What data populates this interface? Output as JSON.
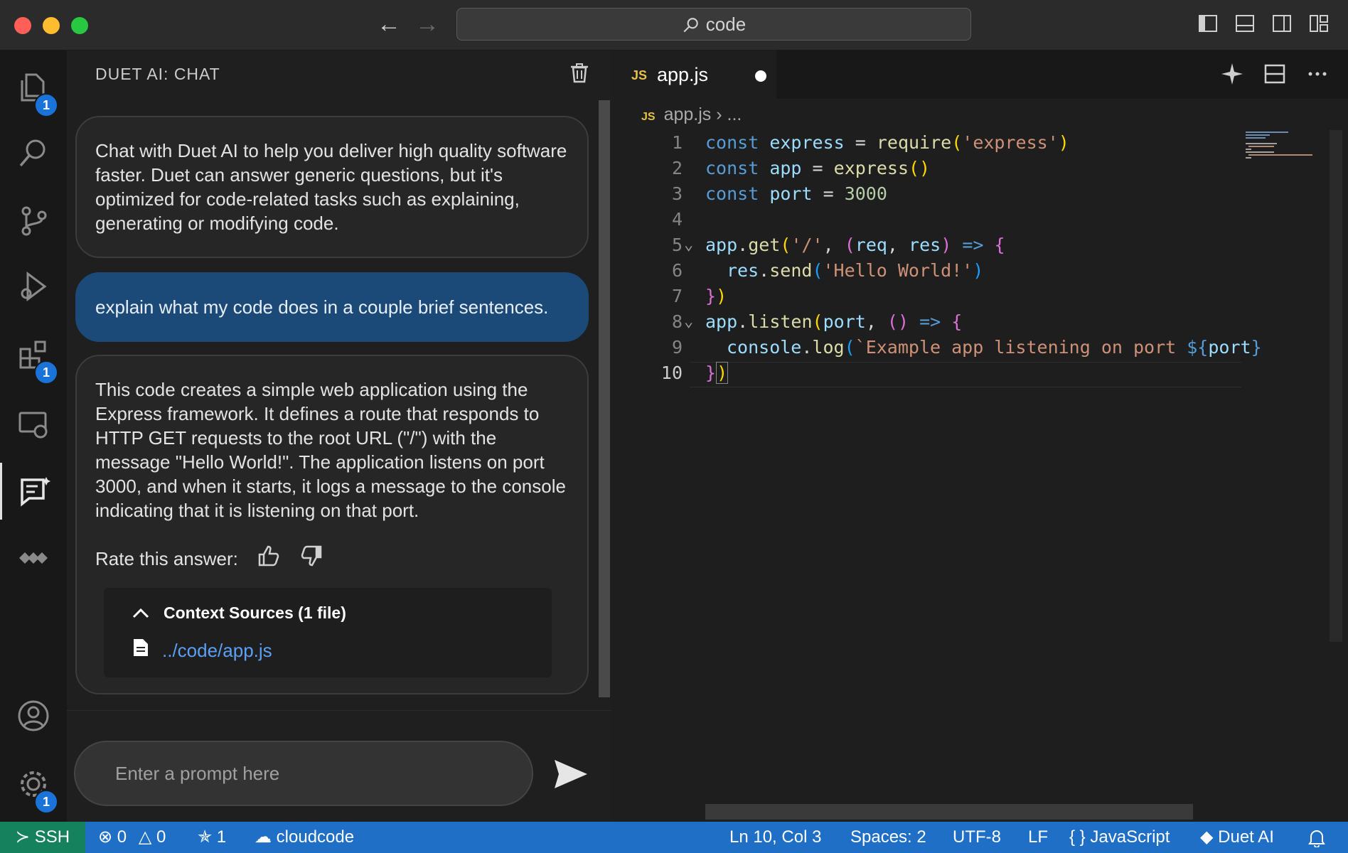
{
  "titlebar": {
    "search_text": "code"
  },
  "activity_bar": {
    "explorer_badge": "1",
    "extensions_badge": "1",
    "settings_badge": "1"
  },
  "chat": {
    "panel_title": "DUET AI: CHAT",
    "intro_message": "Chat with Duet AI to help you deliver high quality software faster. Duet can answer generic questions, but it's optimized for code-related tasks such as explaining, generating or modifying code.",
    "user_message": "explain what my code does in a couple brief sentences.",
    "ai_answer": "This code creates a simple web application using the Express framework. It defines a route that responds to HTTP GET requests to the root URL (\"/\") with the message \"Hello World!\". The application listens on port 3000, and when it starts, it logs a message to the console indicating that it is listening on that port.",
    "rate_label": "Rate this answer:",
    "context_title": "Context Sources (1 file)",
    "context_file": "../code/app.js",
    "prompt_placeholder": "Enter a prompt here"
  },
  "editor": {
    "tab_badge": "JS",
    "tab_name": "app.js",
    "breadcrumb_file": "app.js",
    "breadcrumb_rest": "...",
    "lines": [
      {
        "n": "1",
        "text": "const express = require('express')"
      },
      {
        "n": "2",
        "text": "const app = express()"
      },
      {
        "n": "3",
        "text": "const port = 3000"
      },
      {
        "n": "4",
        "text": ""
      },
      {
        "n": "5",
        "text": "app.get('/', (req, res) => {"
      },
      {
        "n": "6",
        "text": "res.send('Hello World!')"
      },
      {
        "n": "7",
        "text": "})"
      },
      {
        "n": "8",
        "text": "app.listen(port, () => {"
      },
      {
        "n": "9",
        "text": "console.log(`Example app listening on port ${port}"
      },
      {
        "n": "10",
        "text": "})"
      }
    ]
  },
  "statusbar": {
    "remote": "SSH",
    "errors": "0",
    "warnings": "0",
    "ports": "1",
    "cloud": "cloudcode",
    "position": "Ln 10, Col 3",
    "spaces": "Spaces: 2",
    "encoding": "UTF-8",
    "eol": "LF",
    "language": "JavaScript",
    "duet": "Duet AI"
  },
  "colors": {
    "accent": "#1f6fc7",
    "remote": "#16825d",
    "user_bubble": "#1c4a78",
    "badge": "#1a73d9"
  }
}
